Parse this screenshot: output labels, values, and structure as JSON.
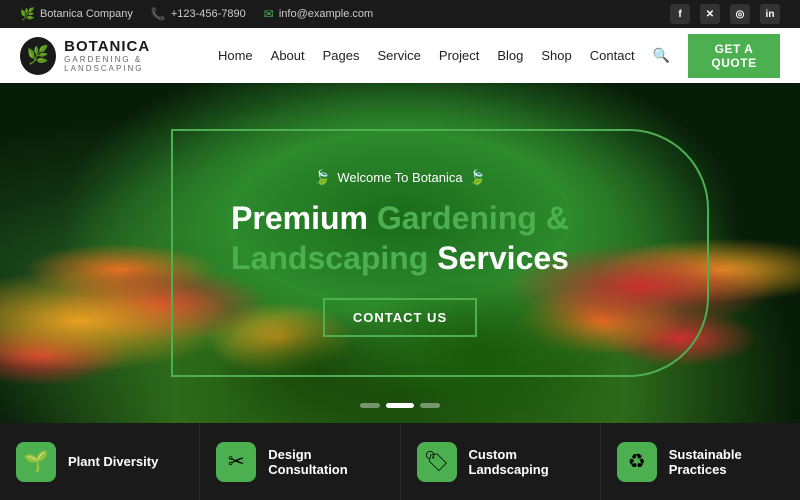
{
  "topbar": {
    "company": "Botanica Company",
    "phone": "+123-456-7890",
    "email": "info@example.com",
    "socials": [
      "f",
      "𝕏",
      "⊙",
      "in"
    ]
  },
  "header": {
    "logo_name": "BOTANICA",
    "logo_sub": "GARDENING & LANDSCAPING",
    "nav": [
      "Home",
      "About",
      "Pages",
      "Service",
      "Project",
      "Blog",
      "Shop",
      "Contact"
    ],
    "cta": "GET A QUOTE"
  },
  "hero": {
    "tagline": "Welcome To Botanica",
    "title_line1": "Premium",
    "title_green1": "Gardening &",
    "title_green2": "Landscaping",
    "title_line2": "Services",
    "cta": "CONTACT US",
    "dots": [
      1,
      2,
      3
    ]
  },
  "cards": [
    {
      "icon": "🌱",
      "label": "Plant Diversity"
    },
    {
      "icon": "✂",
      "label": "Design Consultation"
    },
    {
      "icon": "🏷",
      "label": "Custom Landscaping"
    },
    {
      "icon": "♻",
      "label": "Sustainable Practices"
    }
  ]
}
